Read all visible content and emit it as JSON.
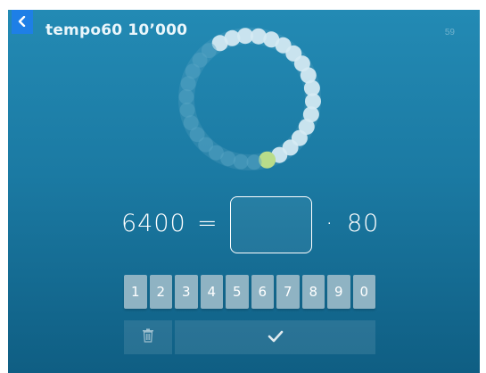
{
  "header": {
    "title": "tempo60 10’000",
    "counter": "59"
  },
  "progress": {
    "total_dots": 30,
    "completed_dots": 16,
    "current_dot": 1,
    "colors": {
      "completed": "#d6eaf3",
      "current": "#b9dc8a",
      "pending": "#5aa6c6"
    }
  },
  "equation": {
    "left": "6400",
    "equals": "=",
    "answer": "",
    "operator": "·",
    "right": "80"
  },
  "keypad": {
    "keys": [
      "1",
      "2",
      "3",
      "4",
      "5",
      "6",
      "7",
      "8",
      "9",
      "0"
    ]
  },
  "icons": {
    "back": "chevron-left-icon",
    "delete": "trash-icon",
    "confirm": "check-icon"
  }
}
